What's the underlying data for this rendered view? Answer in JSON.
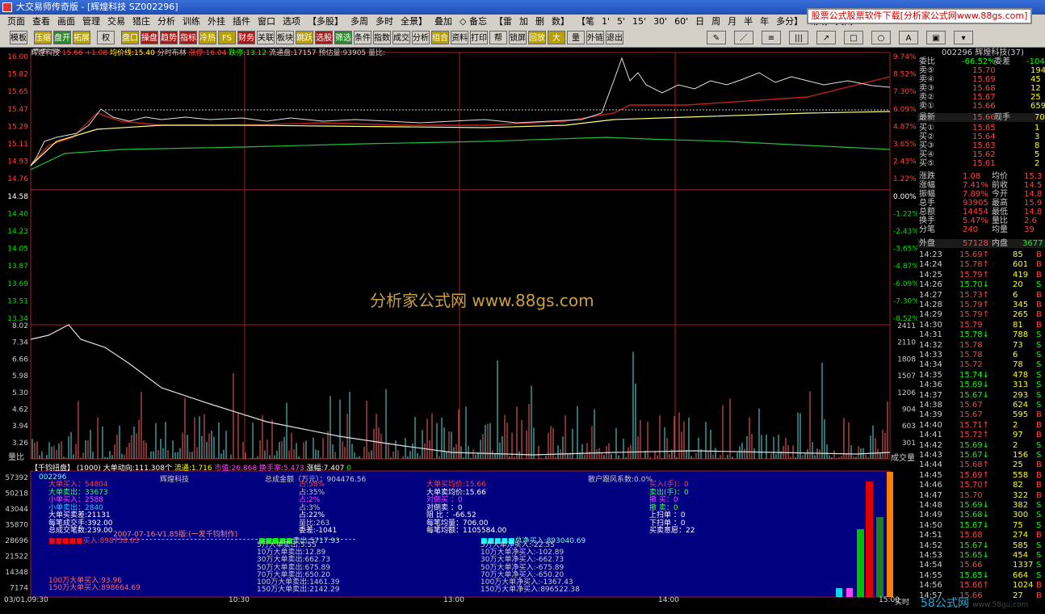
{
  "window": {
    "title": "大交易师传奇版 - [辉煌科技 SZ002296]"
  },
  "ad_banner": "股票公式股票软件下载[分析家公式网www.88gs.com]",
  "menu": [
    "页面",
    "查看",
    "画面",
    "管理",
    "交易",
    "猎庄",
    "分析",
    "训练",
    "外挂",
    "插件",
    "窗口",
    "选项",
    "【多股】",
    "多周",
    "多时",
    "全景】",
    "叠加",
    "◇ 备忘",
    "【雷",
    "加",
    "删",
    "数】",
    "【笔",
    "1'",
    "5'",
    "15'",
    "30'",
    "60'",
    "日",
    "周",
    "月",
    "半",
    "年",
    "多分】",
    "帮助",
    "关闭"
  ],
  "toolbar": {
    "buttons": [
      "模板",
      "压缩",
      "盘开",
      "拓展",
      "权",
      "盘口",
      "操盘",
      "趋势",
      "指标",
      "冷热",
      "FS",
      "财务",
      "关联",
      "板块",
      "跳跃",
      "选股",
      "筛选",
      "条件",
      "指数",
      "成交",
      "分析",
      "组合",
      "资料",
      "打印",
      "帮",
      "锁屏",
      "回放",
      "大",
      "量",
      "外链",
      "退出"
    ]
  },
  "main_chart": {
    "header": {
      "name": "辉煌科技",
      "price": "15.66",
      "change": "+1.08",
      "avg_label": "均价线:15.40",
      "mode": "分时布林",
      "limit_up": "涨停:16.04",
      "limit_down": "跌停:13.12",
      "float": "流通盘:17157",
      "est_vol": "预估量:93905",
      "vol_ratio": "量比:"
    },
    "price_axis": [
      "16.00",
      "15.82",
      "15.65",
      "15.47",
      "15.29",
      "15.11",
      "14.93",
      "14.76",
      "14.58",
      "14.40",
      "14.23",
      "14.05",
      "13.87",
      "13.69",
      "13.51",
      "13.34"
    ],
    "pct_axis": [
      "9.74%",
      "8.52%",
      "7.30%",
      "6.09%",
      "4.87%",
      "3.65%",
      "2.43%",
      "1.22%",
      "0.00%",
      "-1.22%",
      "-2.43%",
      "-3.65%",
      "-4.87%",
      "-6.09%",
      "-7.30%",
      "-8.52%"
    ]
  },
  "volume_chart": {
    "left_axis": [
      "8.02",
      "7.34",
      "6.66",
      "5.98",
      "5.30",
      "4.62",
      "3.94",
      "3.26"
    ],
    "left_label": "量比",
    "right_axis": [
      "2411",
      "2110",
      "1808",
      "1507",
      "1206",
      "904",
      "603",
      "301"
    ],
    "right_label": "成交量"
  },
  "bottom_panel": {
    "header": {
      "title": "【千钧扭盘】",
      "params": "(1000)",
      "line1": "大单动向:111.308个",
      "line2": "流通:1.716",
      "line3": "市值:26.868",
      "line4": "换手率:5.473",
      "line5": "涨幅:7.407",
      "line6": "0"
    },
    "left_axis": [
      "57392",
      "50218",
      "43044",
      "35870",
      "28696",
      "21522",
      "14348",
      "7174"
    ],
    "code": "002296",
    "name": "辉煌科技",
    "total_amount": "总成金额（万元）：904476.56",
    "retail": "散户跟风系数:0.0%",
    "col1": [
      "大单买入：54804",
      "大单卖出：33673",
      "小单买入：2588",
      "小单卖出：2840",
      "大单买卖差:21131",
      "每笔成交手:392.00",
      "总成交笔数:239.00"
    ],
    "col2": [
      "占:58%",
      "占:35%",
      "占:2%",
      "占:3%",
      "占:22%",
      "量比:263",
      "委差:-1041"
    ],
    "col3": [
      "大单买均价:15.66",
      "大单卖均价:15.66",
      "对倒买  ：0",
      "对倒卖  ：0",
      "阻  比  ：-66.52",
      "每笔均量：706.00",
      "每笔均额：1105584.00"
    ],
    "col4": [
      "买入(手)：0",
      "卖出(手)：0",
      "撤  买：0",
      "撤  卖：0",
      "上扫单  ：0",
      "下扫单  ：0",
      "买卖意愿：22"
    ],
    "version": "2007-07-16-V1.85版:(一发千钧制作)",
    "buy_total": "买入:898758.63",
    "sell_total": "卖出:5717.93",
    "net_total": "总净买入:893040.69",
    "sell_list": [
      "5万大单卖出:5.55",
      "10万大单卖出:12.89",
      "30万大单卖出:662.73",
      "50万大单卖出:675.89",
      "70万大单卖出:650.20",
      "100万大单卖出:1461.39",
      "150万大单卖出:2142.29"
    ],
    "net_list": [
      "5万大单净买入:-22.55",
      "10万大单净买入:-102.89",
      "30万大单净买入:-662.73",
      "50万大单净买入:-675.89",
      "70万大单净买入:-650.20",
      "100万大单净买入:-1367.43",
      "150万大单净买入:896522.38"
    ],
    "buy_list": [
      "100万大单买入:93.96",
      "150万大单买入:898664.69"
    ]
  },
  "time_axis": [
    "03/01,09:30",
    "10:30",
    "13:00",
    "14:00",
    "15:00"
  ],
  "right_panel": {
    "header": "002296 辉煌科技(37)",
    "wb": {
      "label1": "委比",
      "val1": "-66.52%",
      "label2": "委差",
      "val2": "-1041"
    },
    "asks": [
      {
        "l": "卖⑤",
        "p": "15.70",
        "v": "1948"
      },
      {
        "l": "卖④",
        "p": "15.69",
        "v": "45"
      },
      {
        "l": "卖③",
        "p": "15.68",
        "v": "12"
      },
      {
        "l": "卖②",
        "p": "15.67",
        "v": "25"
      },
      {
        "l": "卖①",
        "p": "15.66",
        "v": "659"
      }
    ],
    "last": {
      "label": "最新",
      "price": "15.66",
      "label2": "现手",
      "val2": "70"
    },
    "bids": [
      {
        "l": "买①",
        "p": "15.65",
        "v": "1"
      },
      {
        "l": "买②",
        "p": "15.64",
        "v": "3"
      },
      {
        "l": "买③",
        "p": "15.63",
        "v": "8"
      },
      {
        "l": "买④",
        "p": "15.62",
        "v": "5"
      },
      {
        "l": "买⑤",
        "p": "15.61",
        "v": "2"
      }
    ],
    "stats": [
      [
        "涨跌",
        "1.08",
        "均价",
        "15.3"
      ],
      [
        "涨幅",
        "7.41%",
        "前收",
        "14.5"
      ],
      [
        "振幅",
        "7.89%",
        "今开",
        "14.8"
      ],
      [
        "总手",
        "93905",
        "最高",
        "15.9"
      ],
      [
        "总额",
        "14454",
        "最低",
        "14.8"
      ],
      [
        "换手",
        "5.47%",
        "量比",
        "2.6"
      ],
      [
        "分笔",
        "240",
        "均量",
        "39"
      ]
    ],
    "outer": {
      "label": "外盘",
      "val": "57128",
      "label2": "内盘",
      "val2": "3677"
    },
    "ticks": [
      [
        "14:23",
        "15.69↑",
        "85",
        "B"
      ],
      [
        "14:24",
        "15.78↑",
        "601",
        "B"
      ],
      [
        "14:25",
        "15.79↑",
        "419",
        "B"
      ],
      [
        "14:26",
        "15.70↓",
        "20",
        "S"
      ],
      [
        "14:27",
        "15.73↑",
        "6",
        "B"
      ],
      [
        "14:28",
        "15.79↑",
        "345",
        "B"
      ],
      [
        "14:29",
        "15.79↑",
        "265",
        "B"
      ],
      [
        "14:30",
        "15.79",
        "81",
        "B"
      ],
      [
        "14:31",
        "15.78↓",
        "788",
        "S"
      ],
      [
        "14:32",
        "15.78",
        "73",
        "S"
      ],
      [
        "14:33",
        "15.78",
        "6",
        "S"
      ],
      [
        "14:34",
        "15.72",
        "78",
        "S"
      ],
      [
        "14:35",
        "15.74↓",
        "478",
        "S"
      ],
      [
        "14:36",
        "15.69↓",
        "313",
        "S"
      ],
      [
        "14:37",
        "15.67↓",
        "293",
        "S"
      ],
      [
        "14:38",
        "15.67",
        "624",
        "S"
      ],
      [
        "14:39",
        "15.67",
        "595",
        "B"
      ],
      [
        "14:40",
        "15.71↑",
        "2",
        "B"
      ],
      [
        "14:41",
        "15.72↑",
        "97",
        "B"
      ],
      [
        "14:42",
        "15.69↓",
        "2",
        "S"
      ],
      [
        "14:43",
        "15.67↓",
        "156",
        "S"
      ],
      [
        "14:44",
        "15.68↑",
        "25",
        "B"
      ],
      [
        "14:45",
        "15.69↑",
        "558",
        "B"
      ],
      [
        "14:46",
        "15.70↑",
        "82",
        "B"
      ],
      [
        "14:47",
        "15.70",
        "322",
        "B"
      ],
      [
        "14:48",
        "15.69↓",
        "382",
        "S"
      ],
      [
        "14:49",
        "15.68↓",
        "300",
        "S"
      ],
      [
        "14:50",
        "15.67↓",
        "75",
        "S"
      ],
      [
        "14:51",
        "15.68",
        "274",
        "B"
      ],
      [
        "14:52",
        "15.67↓",
        "585",
        "S"
      ],
      [
        "14:53",
        "15.65↓",
        "454",
        "S"
      ],
      [
        "14:54",
        "15.66",
        "1337",
        "S"
      ],
      [
        "14:55",
        "15.65↓",
        "664",
        "S"
      ],
      [
        "14:56",
        "15.66↑",
        "1024",
        "B"
      ],
      [
        "14:57",
        "15.66",
        "27",
        "B"
      ]
    ]
  },
  "watermark": "分析家公式网 www.88gs.com",
  "status": {
    "realtime": "实时",
    "brand": "58公式网",
    "brand_url": "www.58gu.com"
  },
  "colors": {
    "up": "#ff4040",
    "down": "#00e000",
    "axis_red": "#c02020",
    "yellow": "#ffff00",
    "panel_blue": "#000080"
  }
}
